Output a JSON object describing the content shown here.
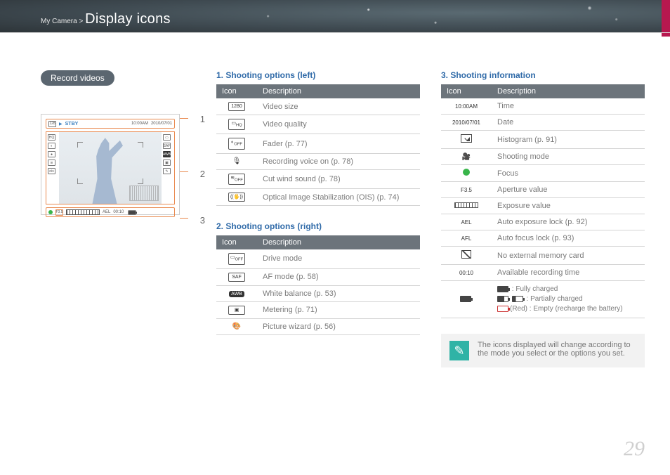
{
  "breadcrumb": {
    "prefix": "My Camera >",
    "title": "Display icons"
  },
  "section_label": "Record videos",
  "callouts": {
    "n1": "1",
    "n2": "2",
    "n3": "3"
  },
  "lcd": {
    "stby": "STBY",
    "time": "10:00AM",
    "date": "2010/07/01",
    "f": "F3.5",
    "ael": "AEL",
    "rec_time": "00:10"
  },
  "col2": {
    "heading1": "1. Shooting options (left)",
    "table1": {
      "h_icon": "Icon",
      "h_desc": "Description",
      "rows": [
        {
          "icon": "1280",
          "desc": "Video size"
        },
        {
          "icon": "HQ",
          "desc": "Video quality"
        },
        {
          "icon": "fader",
          "desc": "Fader (p. 77)"
        },
        {
          "icon": "mic",
          "desc": "Recording voice on (p. 78)"
        },
        {
          "icon": "wind",
          "desc": "Cut wind sound (p. 78)"
        },
        {
          "icon": "ois",
          "desc": "Optical Image Stabilization (OIS) (p. 74)"
        }
      ]
    },
    "heading2": "2. Shooting options (right)",
    "table2": {
      "h_icon": "Icon",
      "h_desc": "Description",
      "rows": [
        {
          "icon": "drive",
          "desc": "Drive mode"
        },
        {
          "icon": "SAF",
          "desc": "AF mode (p. 58)"
        },
        {
          "icon": "AWB",
          "desc": "White balance (p. 53)"
        },
        {
          "icon": "meter",
          "desc": "Metering (p. 71)"
        },
        {
          "icon": "pw",
          "desc": "Picture wizard (p. 56)"
        }
      ]
    }
  },
  "col3": {
    "heading": "3. Shooting information",
    "table": {
      "h_icon": "Icon",
      "h_desc": "Description",
      "rows": [
        {
          "icon_text": "10:00AM",
          "desc": "Time"
        },
        {
          "icon_text": "2010/07/01",
          "desc": "Date"
        },
        {
          "icon": "hist",
          "desc": "Histogram (p. 91)"
        },
        {
          "icon": "mode",
          "desc": "Shooting mode"
        },
        {
          "icon": "focus",
          "desc": "Focus"
        },
        {
          "icon_text": "F3.5",
          "desc": "Aperture value"
        },
        {
          "icon": "expo",
          "desc": "Exposure value"
        },
        {
          "icon_text": "AEL",
          "desc": "Auto exposure lock (p. 92)"
        },
        {
          "icon_text": "AFL",
          "desc": "Auto focus lock (p. 93)"
        },
        {
          "icon": "card",
          "desc": "No external memory card"
        },
        {
          "icon_text": "00:10",
          "desc": "Available recording time"
        }
      ],
      "battery": {
        "full": " : Fully charged",
        "partial": " : Partially charged",
        "red_prefix": "(Red)",
        "empty": " : Empty (recharge the battery)"
      }
    },
    "note": "The icons displayed will change according to the mode you select or the options you set."
  },
  "page_number": "29"
}
